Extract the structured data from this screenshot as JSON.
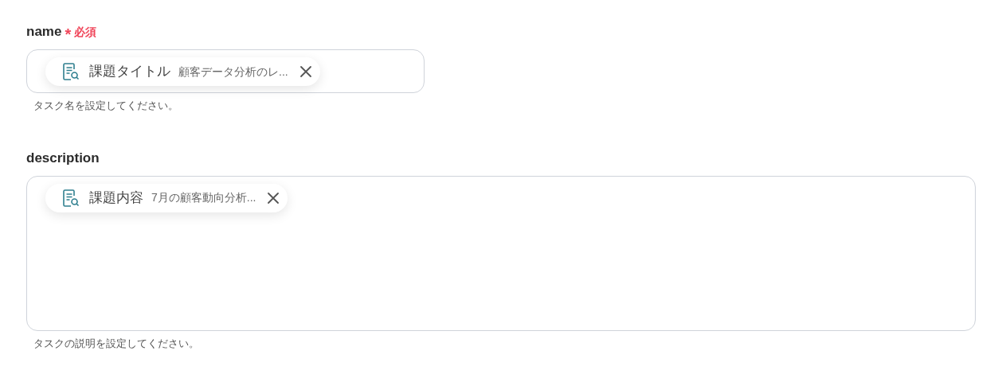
{
  "fields": [
    {
      "label": "name",
      "kind": "single",
      "required_mark": "*",
      "required_text": "必須",
      "chips": [
        {
          "title": "課題タイトル",
          "value": "顧客データ分析のレ..."
        }
      ],
      "help": "タスク名を設定してください。"
    },
    {
      "label": "description",
      "kind": "multi",
      "chips": [
        {
          "title": "課題内容",
          "value": "7月の顧客動向分析..."
        }
      ],
      "help": "タスクの説明を設定してください。"
    }
  ]
}
